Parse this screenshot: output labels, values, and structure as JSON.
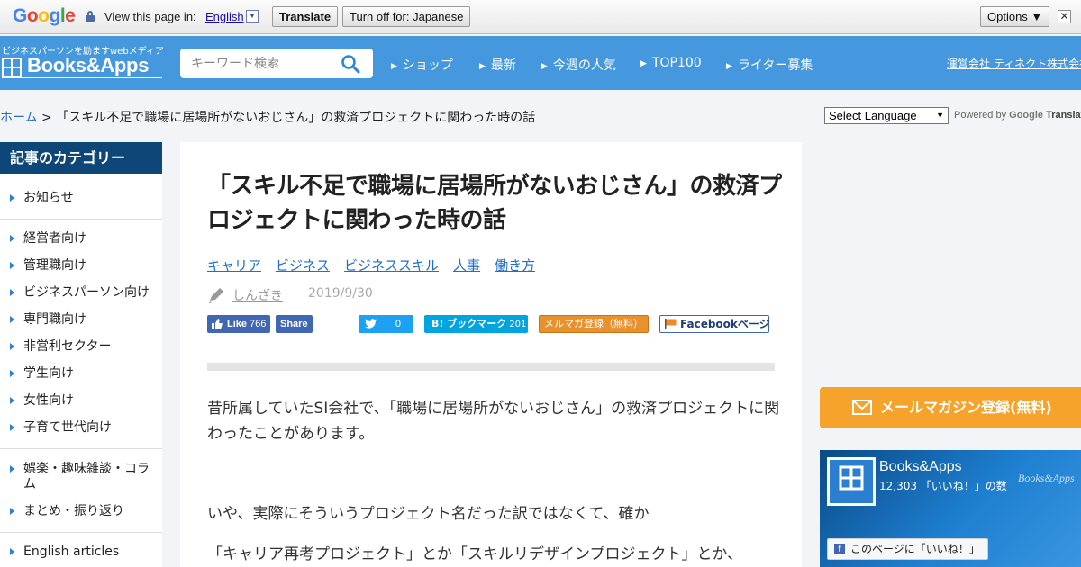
{
  "google_bar": {
    "logo": "Google",
    "view_text": "View this page in:",
    "language": "English",
    "dropdown_glyph": "▼",
    "translate_label": "Translate",
    "turn_off_label": "Turn off for: Japanese",
    "options_label": "Options ▼",
    "close_glyph": "✕"
  },
  "header": {
    "tagline": "ビジネスパーソンを励ますwebメディア",
    "logo_text": "Books&Apps",
    "search_placeholder": "キーワード検索",
    "nav": [
      "ショップ",
      "最新",
      "今週の人気",
      "TOP100",
      "ライター募集"
    ],
    "company_link": "運営会社 ティネクト株式会社",
    "background_color": "#4598de"
  },
  "breadcrumb": {
    "home": "ホーム",
    "separator": " > ",
    "current": "「スキル不足で職場に居場所がないおじさん」の救済プロジェクトに関わった時の話"
  },
  "language_selector": {
    "label": "Select Language",
    "caret": "▼",
    "powered_by": "Powered by",
    "google": "Google",
    "translate": "Translate"
  },
  "sidebar": {
    "title": "記事のカテゴリー",
    "groups": [
      [
        "お知らせ"
      ],
      [
        "経営者向け",
        "管理職向け",
        "ビジネスパーソン向け",
        "専門職向け",
        "非営利セクター",
        "学生向け",
        "女性向け",
        "子育て世代向け"
      ],
      [
        "娯楽・趣味雑談・コラム",
        "まとめ・振り返り"
      ],
      [
        "English articles"
      ]
    ]
  },
  "article": {
    "title": "「スキル不足で職場に居場所がないおじさん」の救済プロジェクトに関わった時の話",
    "tags": [
      "キャリア",
      "ビジネス",
      "ビジネススキル",
      "人事",
      "働き方"
    ],
    "author": "しんざき",
    "date": "2019/9/30",
    "share": {
      "fb_like": "Like",
      "fb_like_count": "766",
      "fb_share": "Share",
      "tweet_count": "0",
      "hatena_label": "B! ブックマーク",
      "hatena_count": "201",
      "mailmag": "メルマガ登録（無料）",
      "facebook_page": "Facebookページ"
    },
    "paragraphs": [
      "昔所属していたSI会社で、「職場に居場所がないおじさん」の救済プロジェクトに関わったことがあります。",
      "いや、実際にそういうプロジェクト名だった訳ではなくて、確か",
      "「キャリア再考プロジェクト」とか「スキルリデザインプロジェクト」とか、"
    ]
  },
  "right_column": {
    "mailmag_banner": "メールマガジン登録(無料)",
    "fb_widget": {
      "page_name": "Books&Apps",
      "likes_text": "12,303 「いいね！」の数",
      "watermark": "Books&Apps",
      "like_button": "このページに「いいね！」"
    }
  }
}
